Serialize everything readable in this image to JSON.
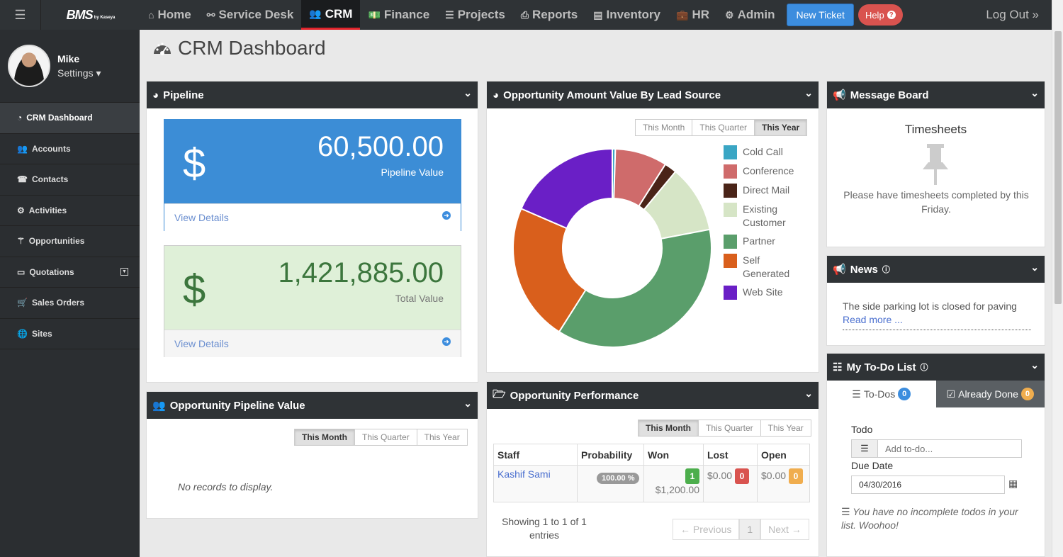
{
  "app": {
    "brand": "BMS",
    "brand_sub": "by Kaseya"
  },
  "nav": {
    "items": [
      {
        "label": "Home",
        "icon": "home-icon"
      },
      {
        "label": "Service Desk",
        "icon": "sitemap-icon"
      },
      {
        "label": "CRM",
        "icon": "users-icon",
        "active": true
      },
      {
        "label": "Finance",
        "icon": "money-icon"
      },
      {
        "label": "Projects",
        "icon": "list-icon"
      },
      {
        "label": "Reports",
        "icon": "print-icon"
      },
      {
        "label": "Inventory",
        "icon": "building-icon"
      },
      {
        "label": "HR",
        "icon": "briefcase-icon"
      },
      {
        "label": "Admin",
        "icon": "gear-icon"
      }
    ],
    "new_ticket": "New Ticket",
    "help": "Help",
    "logout": "Log Out"
  },
  "user": {
    "name": "Mike",
    "settings": "Settings"
  },
  "sidebar": {
    "items": [
      {
        "label": "CRM Dashboard",
        "icon": "dashboard-icon",
        "active": true
      },
      {
        "label": "Accounts",
        "icon": "users-icon"
      },
      {
        "label": "Contacts",
        "icon": "phone-icon"
      },
      {
        "label": "Activities",
        "icon": "cogs-icon"
      },
      {
        "label": "Opportunities",
        "icon": "wand-icon"
      },
      {
        "label": "Quotations",
        "icon": "file-icon"
      },
      {
        "label": "Sales Orders",
        "icon": "cart-icon"
      },
      {
        "label": "Sites",
        "icon": "globe-icon"
      }
    ]
  },
  "page": {
    "title": "CRM Dashboard"
  },
  "pipeline": {
    "title": "Pipeline",
    "pipeline_value": "60,500.00",
    "pipeline_label": "Pipeline Value",
    "total_value": "1,421,885.00",
    "total_label": "Total Value",
    "currency": "$",
    "view_details": "View Details"
  },
  "opp_pipeline": {
    "title": "Opportunity Pipeline Value",
    "periods": [
      "This Month",
      "This Quarter",
      "This Year"
    ],
    "empty": "No records to display."
  },
  "lead_source": {
    "title": "Opportunity Amount Value By Lead Source",
    "periods": [
      "This Month",
      "This Quarter",
      "This Year"
    ]
  },
  "chart_data": {
    "type": "pie",
    "categories": [
      "Cold Call",
      "Conference",
      "Direct Mail",
      "Existing Customer",
      "Partner",
      "Self Generated",
      "Web Site"
    ],
    "values": [
      0.5,
      8.5,
      2.0,
      11.0,
      37.0,
      22.5,
      18.5
    ],
    "colors": [
      "#3aa6c4",
      "#cf6b6b",
      "#4a2418",
      "#d6e5c6",
      "#5a9e6b",
      "#d95f1c",
      "#6a1fc6"
    ],
    "legend": "right"
  },
  "performance": {
    "title": "Opportunity Performance",
    "periods": [
      "This Month",
      "This Quarter",
      "This Year"
    ],
    "columns": [
      "Staff",
      "Probability",
      "Won",
      "Lost",
      "Open"
    ],
    "row": {
      "staff": "Kashif Sami",
      "probability": "100.00 %",
      "won_count": "1",
      "won_amount": "$1,200.00",
      "lost_amount": "$0.00",
      "lost_count": "0",
      "open_amount": "$0.00",
      "open_count": "0"
    },
    "showing": "Showing 1 to 1 of 1 entries",
    "prev": "← Previous",
    "page": "1",
    "next": "Next →"
  },
  "message_board": {
    "title": "Message Board",
    "heading": "Timesheets",
    "text": "Please have timesheets completed by this Friday."
  },
  "news": {
    "title": "News",
    "text": "The side parking lot is closed for paving",
    "read_more": "Read more ..."
  },
  "todo": {
    "title": "My To-Do List",
    "tab_todos": "To-Dos",
    "tab_todos_count": "0",
    "tab_done": "Already Done",
    "tab_done_count": "0",
    "todo_label": "Todo",
    "todo_placeholder": "Add to-do...",
    "due_label": "Due Date",
    "due_value": "04/30/2016",
    "empty": "You have no incomplete todos in your list. Woohoo!"
  }
}
